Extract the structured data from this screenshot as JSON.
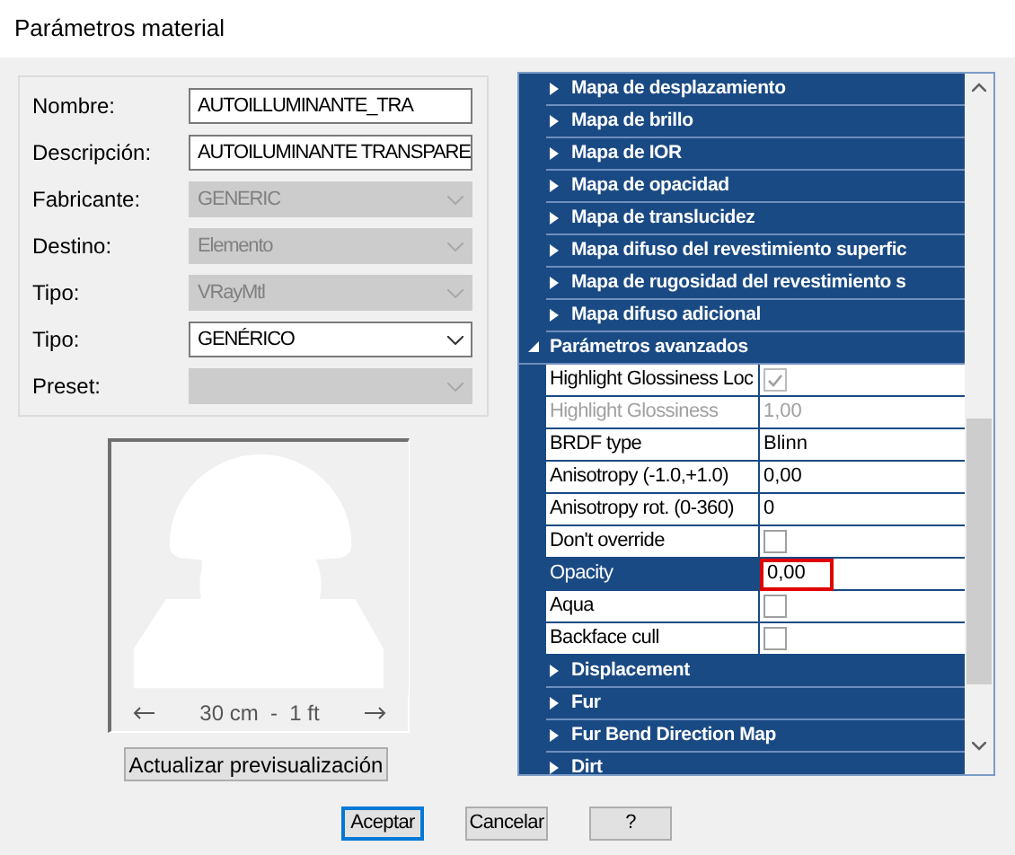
{
  "window": {
    "title": "Parámetros material"
  },
  "form": {
    "fields": [
      {
        "label": "Nombre:",
        "value": "AUTOILLUMINANTE_TRA",
        "kind": "text",
        "disabled": false
      },
      {
        "label": "Descripción:",
        "value": "AUTOILUMINANTE TRANSPARE",
        "kind": "text",
        "disabled": false
      },
      {
        "label": "Fabricante:",
        "value": "GENERIC",
        "kind": "select",
        "disabled": true
      },
      {
        "label": "Destino:",
        "value": "Elemento",
        "kind": "select",
        "disabled": true
      },
      {
        "label": "Tipo:",
        "value": "VRayMtl",
        "kind": "select",
        "disabled": true
      },
      {
        "label": "Tipo:",
        "value": "GENÉRICO",
        "kind": "select",
        "disabled": false
      },
      {
        "label": "Preset:",
        "kind": "select",
        "disabled": true
      }
    ]
  },
  "preview": {
    "scale": "30 cm  -  1 ft",
    "button": "Actualizar previsualización"
  },
  "panel": {
    "sections": [
      {
        "label": "Mapa de desplazamiento",
        "expanded": false
      },
      {
        "label": "Mapa de brillo",
        "expanded": false
      },
      {
        "label": "Mapa de IOR",
        "expanded": false
      },
      {
        "label": "Mapa de opacidad",
        "expanded": false
      },
      {
        "label": "Mapa de translucidez",
        "expanded": false
      },
      {
        "label": "Mapa difuso del revestimiento superfic",
        "expanded": false
      },
      {
        "label": "Mapa de rugosidad del revestimiento s",
        "expanded": false
      },
      {
        "label": "Mapa difuso adicional",
        "expanded": false
      },
      {
        "label": "Parámetros avanzados",
        "expanded": true,
        "properties": [
          {
            "name": "Highlight Glossiness Loc",
            "kind": "check",
            "checked": true,
            "disabled": true,
            "selected": false
          },
          {
            "name": "Highlight Glossiness",
            "kind": "text",
            "value": "1,00",
            "disabled": true,
            "selected": false
          },
          {
            "name": "BRDF type",
            "kind": "text",
            "value": "Blinn",
            "disabled": false,
            "selected": false
          },
          {
            "name": "Anisotropy (-1.0,+1.0)",
            "kind": "text",
            "value": "0,00",
            "disabled": false,
            "selected": false
          },
          {
            "name": "Anisotropy rot. (0-360)",
            "kind": "text",
            "value": "0",
            "disabled": false,
            "selected": false
          },
          {
            "name": "Don't override",
            "kind": "check",
            "checked": false,
            "disabled": false,
            "selected": false
          },
          {
            "name": "Opacity",
            "kind": "text",
            "value": "0,00",
            "disabled": false,
            "selected": true
          },
          {
            "name": "Aqua",
            "kind": "check",
            "checked": false,
            "disabled": false,
            "selected": false
          },
          {
            "name": "Backface cull",
            "kind": "check",
            "checked": false,
            "disabled": false,
            "selected": false
          }
        ]
      },
      {
        "label": "Displacement",
        "expanded": false
      },
      {
        "label": "Fur",
        "expanded": false
      },
      {
        "label": "Fur Bend Direction Map",
        "expanded": false
      },
      {
        "label": "Dirt",
        "expanded": false
      }
    ]
  },
  "buttons": [
    {
      "label": "Aceptar",
      "default": true
    },
    {
      "label": "Cancelar",
      "default": false
    },
    {
      "label": "?",
      "default": false
    }
  ]
}
